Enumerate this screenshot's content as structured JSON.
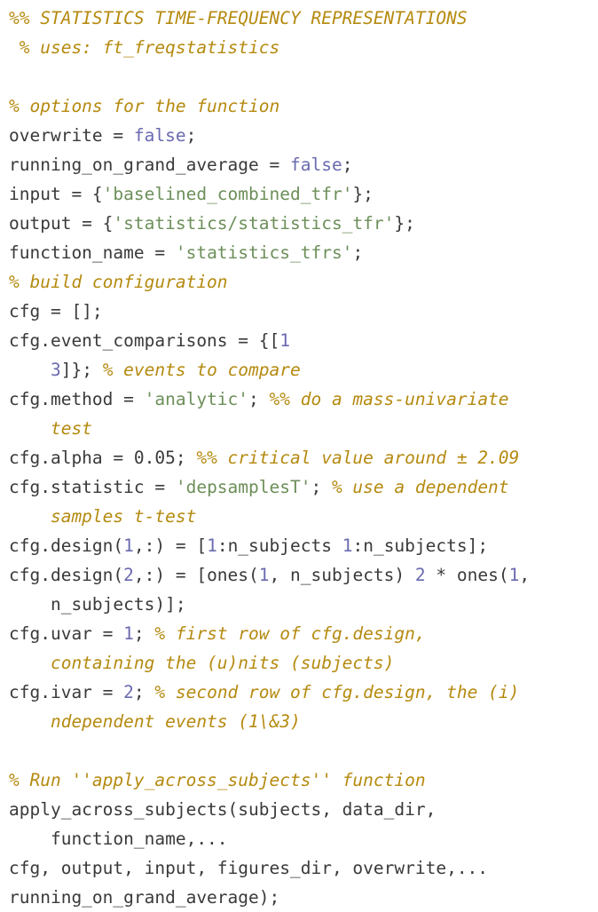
{
  "editor": {
    "language": "matlab",
    "colors": {
      "background": "#ffffff",
      "plain": "#3a3a3a",
      "comment": "#b58a10",
      "string": "#6d8f5a",
      "keyword": "#6a6ab0",
      "number": "#6a6ab0"
    }
  },
  "lines": [
    {
      "id": "line-1",
      "tokens": [
        {
          "type": "comment",
          "text": "%% STATISTICS TIME-FREQUENCY REPRESENTATIONS"
        }
      ]
    },
    {
      "id": "line-2",
      "tokens": [
        {
          "type": "comment",
          "text": " % uses: ft_freqstatistics"
        }
      ]
    },
    {
      "id": "line-3",
      "tokens": [
        {
          "type": "plain",
          "text": ""
        }
      ]
    },
    {
      "id": "line-4",
      "tokens": [
        {
          "type": "comment",
          "text": "% options for the function"
        }
      ]
    },
    {
      "id": "line-5",
      "tokens": [
        {
          "type": "plain",
          "text": "overwrite = "
        },
        {
          "type": "keyword",
          "text": "false"
        },
        {
          "type": "plain",
          "text": ";"
        }
      ]
    },
    {
      "id": "line-6",
      "tokens": [
        {
          "type": "plain",
          "text": "running_on_grand_average = "
        },
        {
          "type": "keyword",
          "text": "false"
        },
        {
          "type": "plain",
          "text": ";"
        }
      ]
    },
    {
      "id": "line-7",
      "tokens": [
        {
          "type": "plain",
          "text": "input = {"
        },
        {
          "type": "string",
          "text": "'baselined_combined_tfr'"
        },
        {
          "type": "plain",
          "text": "};"
        }
      ]
    },
    {
      "id": "line-8",
      "tokens": [
        {
          "type": "plain",
          "text": "output = {"
        },
        {
          "type": "string",
          "text": "'statistics/statistics_tfr'"
        },
        {
          "type": "plain",
          "text": "};"
        }
      ]
    },
    {
      "id": "line-9",
      "tokens": [
        {
          "type": "plain",
          "text": "function_name = "
        },
        {
          "type": "string",
          "text": "'statistics_tfrs'"
        },
        {
          "type": "plain",
          "text": ";"
        }
      ]
    },
    {
      "id": "line-10",
      "tokens": [
        {
          "type": "comment",
          "text": "% build configuration"
        }
      ]
    },
    {
      "id": "line-11",
      "tokens": [
        {
          "type": "plain",
          "text": "cfg = [];"
        }
      ]
    },
    {
      "id": "line-12",
      "tokens": [
        {
          "type": "plain",
          "text": "cfg.event_comparisons = {["
        },
        {
          "type": "number",
          "text": "1"
        }
      ]
    },
    {
      "id": "line-13",
      "tokens": [
        {
          "type": "plain",
          "text": "    "
        },
        {
          "type": "number",
          "text": "3"
        },
        {
          "type": "plain",
          "text": "]}; "
        },
        {
          "type": "comment",
          "text": "% events to compare"
        }
      ]
    },
    {
      "id": "line-14",
      "tokens": [
        {
          "type": "plain",
          "text": "cfg.method = "
        },
        {
          "type": "string",
          "text": "'analytic'"
        },
        {
          "type": "plain",
          "text": "; "
        },
        {
          "type": "comment",
          "text": "%% do a mass-univariate"
        }
      ]
    },
    {
      "id": "line-15",
      "tokens": [
        {
          "type": "comment",
          "text": "    test"
        }
      ]
    },
    {
      "id": "line-16",
      "tokens": [
        {
          "type": "plain",
          "text": "cfg.alpha = 0.05; "
        },
        {
          "type": "comment",
          "text": "%% critical value around ± 2.09"
        }
      ]
    },
    {
      "id": "line-17",
      "tokens": [
        {
          "type": "plain",
          "text": "cfg.statistic = "
        },
        {
          "type": "string",
          "text": "'depsamplesT'"
        },
        {
          "type": "plain",
          "text": "; "
        },
        {
          "type": "comment",
          "text": "% use a dependent"
        }
      ]
    },
    {
      "id": "line-18",
      "tokens": [
        {
          "type": "comment",
          "text": "    samples t-test"
        }
      ]
    },
    {
      "id": "line-19",
      "tokens": [
        {
          "type": "plain",
          "text": "cfg.design("
        },
        {
          "type": "number",
          "text": "1"
        },
        {
          "type": "plain",
          "text": ",:) = ["
        },
        {
          "type": "number",
          "text": "1"
        },
        {
          "type": "plain",
          "text": ":n_subjects "
        },
        {
          "type": "number",
          "text": "1"
        },
        {
          "type": "plain",
          "text": ":n_subjects];"
        }
      ]
    },
    {
      "id": "line-20",
      "tokens": [
        {
          "type": "plain",
          "text": "cfg.design("
        },
        {
          "type": "number",
          "text": "2"
        },
        {
          "type": "plain",
          "text": ",:) = [ones("
        },
        {
          "type": "number",
          "text": "1"
        },
        {
          "type": "plain",
          "text": ", n_subjects) "
        },
        {
          "type": "number",
          "text": "2"
        },
        {
          "type": "plain",
          "text": " * ones("
        },
        {
          "type": "number",
          "text": "1"
        },
        {
          "type": "plain",
          "text": ","
        }
      ]
    },
    {
      "id": "line-21",
      "tokens": [
        {
          "type": "plain",
          "text": "    n_subjects)];"
        }
      ]
    },
    {
      "id": "line-22",
      "tokens": [
        {
          "type": "plain",
          "text": "cfg.uvar = "
        },
        {
          "type": "number",
          "text": "1"
        },
        {
          "type": "plain",
          "text": "; "
        },
        {
          "type": "comment",
          "text": "% first row of cfg.design,"
        }
      ]
    },
    {
      "id": "line-23",
      "tokens": [
        {
          "type": "comment",
          "text": "    containing the (u)nits (subjects)"
        }
      ]
    },
    {
      "id": "line-24",
      "tokens": [
        {
          "type": "plain",
          "text": "cfg.ivar = "
        },
        {
          "type": "number",
          "text": "2"
        },
        {
          "type": "plain",
          "text": "; "
        },
        {
          "type": "comment",
          "text": "% second row of cfg.design, the (i)"
        }
      ]
    },
    {
      "id": "line-25",
      "tokens": [
        {
          "type": "comment",
          "text": "    ndependent events (1\\&3)"
        }
      ]
    },
    {
      "id": "line-26",
      "tokens": [
        {
          "type": "plain",
          "text": ""
        }
      ]
    },
    {
      "id": "line-27",
      "tokens": [
        {
          "type": "comment",
          "text": "% Run ''apply_across_subjects'' function"
        }
      ]
    },
    {
      "id": "line-28",
      "tokens": [
        {
          "type": "plain",
          "text": "apply_across_subjects(subjects, data_dir,"
        }
      ]
    },
    {
      "id": "line-29",
      "tokens": [
        {
          "type": "plain",
          "text": "    function_name,..."
        }
      ]
    },
    {
      "id": "line-30",
      "tokens": [
        {
          "type": "plain",
          "text": "cfg, output, input, figures_dir, overwrite,..."
        }
      ]
    },
    {
      "id": "line-31",
      "tokens": [
        {
          "type": "plain",
          "text": "running_on_grand_average);"
        }
      ]
    }
  ]
}
